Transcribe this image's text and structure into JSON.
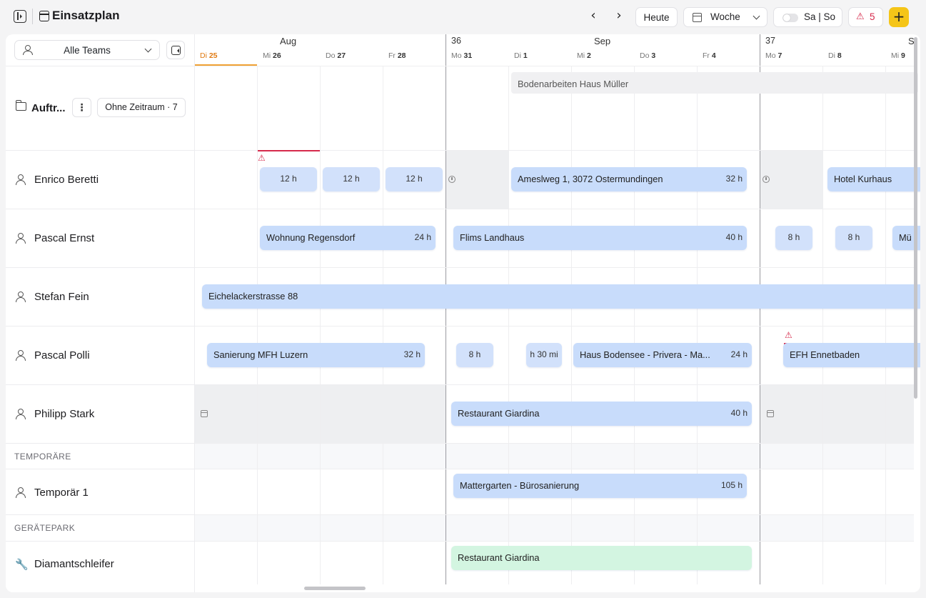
{
  "header": {
    "title": "Einsatzplan",
    "today_label": "Heute",
    "view_label": "Woche",
    "weekend_label": "Sa | So",
    "warning_count": "5",
    "add_label": "+"
  },
  "sidebar": {
    "team_filter": "Alle Teams",
    "auftrage_label": "Auftr...",
    "dots": "⋮",
    "zeitraum_label": "Ohne Zeitraum · 7",
    "rows": [
      {
        "name": "Enrico Beretti"
      },
      {
        "name": "Pascal Ernst"
      },
      {
        "name": "Stefan Fein"
      },
      {
        "name": "Pascal Polli"
      },
      {
        "name": "Philipp Stark"
      }
    ],
    "group_temporaere": "TEMPORÄRE",
    "temp_rows": [
      {
        "name": "Temporär 1"
      }
    ],
    "group_geraetepark": "GERÄTEPARK",
    "equipment_rows": [
      {
        "name": "Diamantschleifer"
      }
    ]
  },
  "calendar": {
    "months": [
      {
        "label": "Aug"
      },
      {
        "label": "Sep"
      },
      {
        "label": "S"
      }
    ],
    "weeks": [
      {
        "label": "36"
      },
      {
        "label": "37"
      }
    ],
    "days": [
      {
        "wd": "Di",
        "num": "25"
      },
      {
        "wd": "Mi",
        "num": "26"
      },
      {
        "wd": "Do",
        "num": "27"
      },
      {
        "wd": "Fr",
        "num": "28"
      },
      {
        "wd": "Mo",
        "num": "31"
      },
      {
        "wd": "Di",
        "num": "1"
      },
      {
        "wd": "Mi",
        "num": "2"
      },
      {
        "wd": "Do",
        "num": "3"
      },
      {
        "wd": "Fr",
        "num": "4"
      },
      {
        "wd": "Mo",
        "num": "7"
      },
      {
        "wd": "Di",
        "num": "8"
      },
      {
        "wd": "Mi",
        "num": "9"
      }
    ],
    "events": {
      "bodenarbeiten": "Bodenarbeiten Haus Müller",
      "enrico_12a": "12 h",
      "enrico_12b": "12 h",
      "enrico_12c": "12 h",
      "amesl": "Ameslweg 1, 3072 Ostermundingen",
      "amesl_h": "32 h",
      "kurhaus": "Hotel Kurhaus",
      "regensdorf": "Wohnung Regensdorf",
      "regensdorf_h": "24 h",
      "flims": "Flims Landhaus",
      "flims_h": "40 h",
      "ernst_8a": "8 h",
      "ernst_8b": "8 h",
      "ernst_mue": "Mü",
      "eichelacker": "Eichelackerstrasse 88",
      "luzern": "Sanierung MFH Luzern",
      "luzern_h": "32 h",
      "polli_8": "8 h",
      "polli_30": "h 30 mi",
      "bodensee": "Haus Bodensee - Privera - Ma...",
      "bodensee_h": "24 h",
      "ennetbaden": "EFH Ennetbaden",
      "giardina": "Restaurant Giardina",
      "giardina_h": "40 h",
      "mattergarten": "Mattergarten - Bürosanierung",
      "mattergarten_h": "105 h",
      "giardina2": "Restaurant Giardina"
    }
  },
  "colors": {
    "accent": "#f5c518",
    "event_blue": "#c8dcfb",
    "event_green": "#d3f5e1",
    "today": "#e07a12",
    "warning": "#d62a4b"
  }
}
